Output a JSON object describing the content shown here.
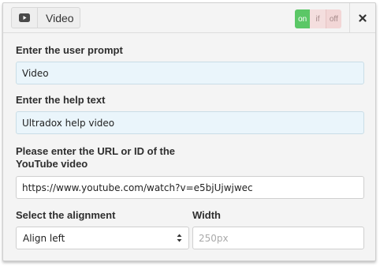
{
  "header": {
    "title": "Video",
    "toggle": {
      "on": "on",
      "if": "if",
      "off": "off",
      "selected": "on"
    }
  },
  "form": {
    "user_prompt": {
      "label": "Enter the user prompt",
      "value": "Video"
    },
    "help_text": {
      "label": "Enter the help text",
      "value": "Ultradox help video"
    },
    "url": {
      "label_line1": "Please enter the URL or ID of the",
      "label_line2": "YouTube video",
      "value": "https://www.youtube.com/watch?v=e5bjUjwjwec"
    },
    "alignment": {
      "label": "Select the alignment",
      "selected": "Align left"
    },
    "width": {
      "label": "Width",
      "placeholder": "250px"
    }
  },
  "colors": {
    "on": "#5bc766",
    "field_bg": "#eaf5fb",
    "panel_bg": "#f4f4f4"
  }
}
